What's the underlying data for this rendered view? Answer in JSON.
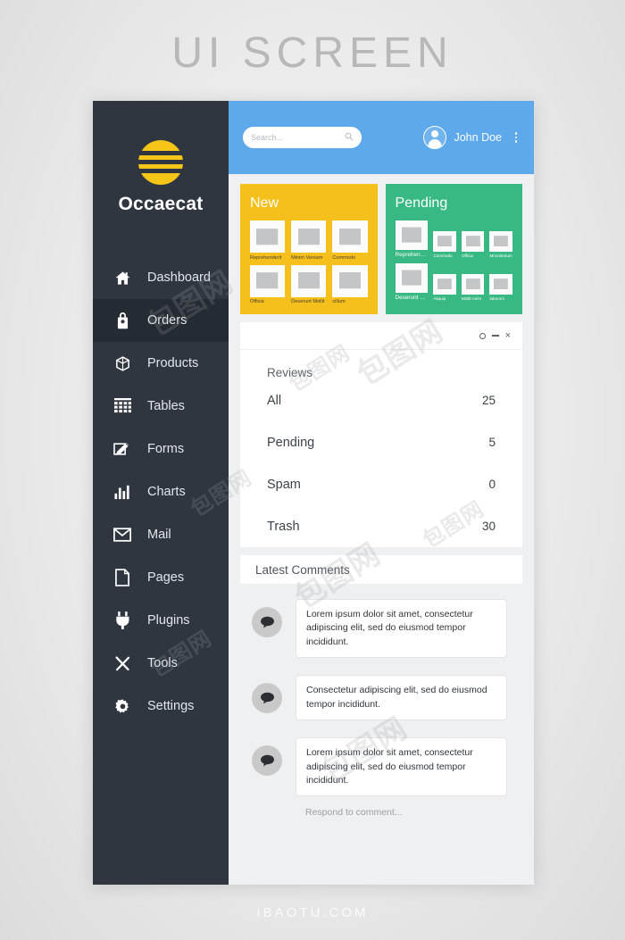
{
  "page": {
    "title": "UI SCREEN",
    "footer": "IBAOTU.COM",
    "watermark": "包图网"
  },
  "colors": {
    "sidebar": "#2f3640",
    "sidebar_active": "#252b33",
    "header_blue": "#5da9ec",
    "card_new_yellow": "#f5c01c",
    "card_pending_green": "#38b883",
    "logo_yellow": "#f5c518",
    "page_bg": "#eef0f1"
  },
  "sidebar": {
    "brand": "Occaecat",
    "logo_icon": "striped-circle-logo",
    "items": [
      {
        "label": "Dashboard",
        "icon": "home-icon",
        "active": false
      },
      {
        "label": "Orders",
        "icon": "tag-icon",
        "active": true
      },
      {
        "label": "Products",
        "icon": "box-icon",
        "active": false
      },
      {
        "label": "Tables",
        "icon": "grid-icon",
        "active": false
      },
      {
        "label": "Forms",
        "icon": "form-pencil-icon",
        "active": false
      },
      {
        "label": "Charts",
        "icon": "bar-chart-icon",
        "active": false
      },
      {
        "label": "Mail",
        "icon": "envelope-icon",
        "active": false
      },
      {
        "label": "Pages",
        "icon": "page-icon",
        "active": false
      },
      {
        "label": "Plugins",
        "icon": "plug-icon",
        "active": false
      },
      {
        "label": "Tools",
        "icon": "wrench-screwdriver-icon",
        "active": false
      },
      {
        "label": "Settings",
        "icon": "gear-icon",
        "active": false
      }
    ]
  },
  "header": {
    "search_placeholder": "Search...",
    "search_value": "",
    "search_icon": "search-icon",
    "user_name": "John Doe",
    "avatar_icon": "user-avatar-icon",
    "menu_icon": "kebab-menu-icon"
  },
  "cards": {
    "new": {
      "title": "New",
      "thumbs": [
        {
          "label": "Reprehenderit"
        },
        {
          "label": "Minim Veniam"
        },
        {
          "label": "Commodo"
        },
        {
          "label": "Officia"
        },
        {
          "label": "Deserunt Mollit"
        },
        {
          "label": "cillum"
        }
      ]
    },
    "pending": {
      "title": "Pending",
      "row1": {
        "big": {
          "label": "Reprehenderit"
        },
        "small": [
          {
            "label": "Commodo"
          },
          {
            "label": "Officia"
          },
          {
            "label": "Mnonitorium"
          }
        ]
      },
      "row2": {
        "big": {
          "label": "Deserunt Mollit"
        },
        "small": [
          {
            "label": "Aliquip"
          },
          {
            "label": "Mollit Anim"
          },
          {
            "label": "laborum"
          }
        ]
      }
    }
  },
  "reviews_panel": {
    "window_controls": [
      {
        "name": "restore-icon",
        "glyph": "circle"
      },
      {
        "name": "minimize-icon",
        "glyph": "minus"
      },
      {
        "name": "close-icon",
        "glyph": "×"
      }
    ],
    "heading": "Reviews",
    "rows": [
      {
        "label": "All",
        "value": "25"
      },
      {
        "label": "Pending",
        "value": "5"
      },
      {
        "label": "Spam",
        "value": "0"
      },
      {
        "label": "Trash",
        "value": "30"
      }
    ]
  },
  "comments_panel": {
    "title": "Latest Comments",
    "respond_placeholder": "Respond to comment...",
    "items": [
      {
        "avatar_icon": "comment-bubble-icon",
        "text": "Lorem ipsum dolor sit amet, consectetur adipiscing elit, sed do eiusmod tempor incididunt."
      },
      {
        "avatar_icon": "comment-bubble-icon",
        "text": "Consectetur adipiscing elit, sed do eiusmod tempor incididunt."
      },
      {
        "avatar_icon": "comment-bubble-icon",
        "text": "Lorem ipsum dolor sit amet, consectetur adipiscing elit, sed do eiusmod tempor incididunt."
      }
    ]
  }
}
